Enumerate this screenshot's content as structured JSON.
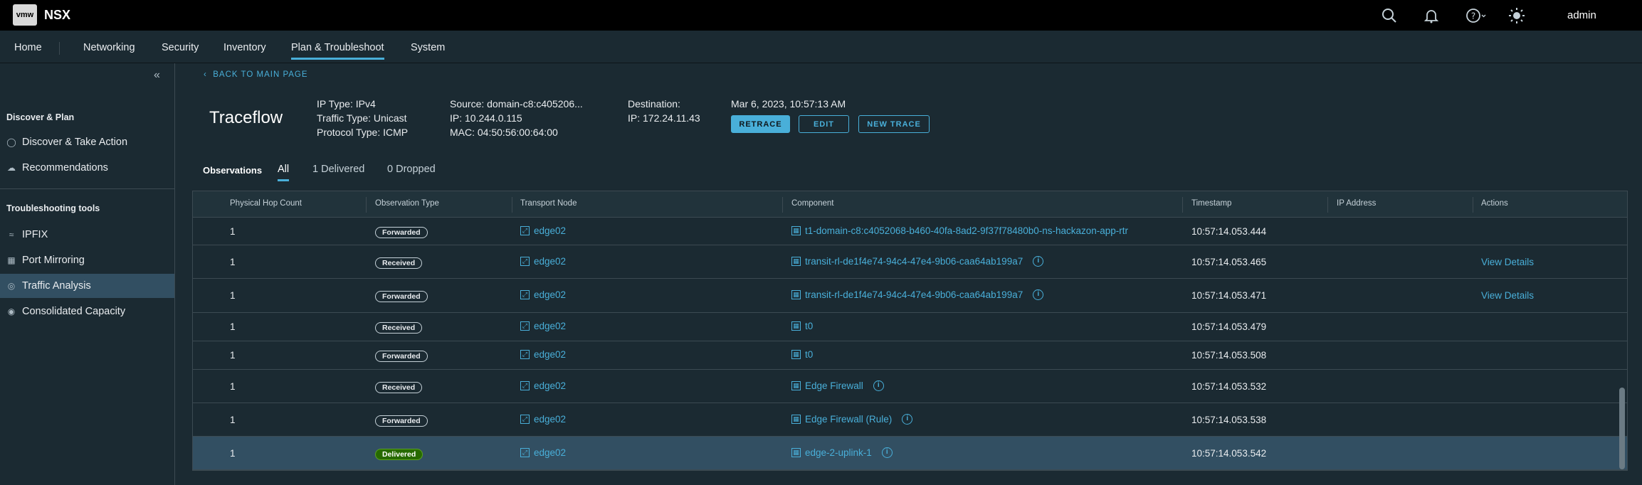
{
  "header": {
    "logo": "vmw",
    "product": "NSX",
    "user": "admin",
    "icons": [
      "search-icon",
      "bell-icon",
      "help-icon",
      "theme-sun-icon"
    ]
  },
  "nav": {
    "tabs": [
      "Home",
      "Networking",
      "Security",
      "Inventory",
      "Plan & Troubleshoot",
      "System"
    ],
    "active": "Plan & Troubleshoot"
  },
  "sidebar": {
    "sections": [
      {
        "title": "Discover & Plan",
        "items": [
          "Discover & Take Action",
          "Recommendations"
        ]
      },
      {
        "title": "Troubleshooting tools",
        "items": [
          "IPFIX",
          "Port Mirroring",
          "Traffic Analysis",
          "Consolidated Capacity"
        ]
      }
    ],
    "active": "Traffic Analysis"
  },
  "page": {
    "back_label": "BACK TO MAIN PAGE",
    "title": "Traceflow",
    "ip_type": "IP Type: IPv4",
    "traffic_type": "Traffic Type: Unicast",
    "protocol_type": "Protocol Type: ICMP",
    "source": "Source: domain-c8:c405206...",
    "source_ip": "IP: 10.244.0.115",
    "source_mac": "MAC: 04:50:56:00:64:00",
    "destination": "Destination:",
    "destination_ip": "IP: 172.24.11.43",
    "date": "Mar 6, 2023, 10:57:13 AM",
    "buttons": {
      "retrace": "RETRACE",
      "edit": "EDIT",
      "new_trace": "NEW TRACE"
    }
  },
  "observations": {
    "label": "Observations",
    "tabs": [
      "All",
      "1 Delivered",
      "0 Dropped"
    ],
    "active": "All"
  },
  "grid": {
    "columns": [
      "Physical Hop Count",
      "Observation Type",
      "Transport Node",
      "Component",
      "Timestamp",
      "IP Address",
      "Actions"
    ],
    "rows": [
      {
        "hop": "1",
        "type": "Forwarded",
        "node": "edge02",
        "component": "t1-domain-c8:c4052068-b460-40fa-8ad2-9f37f78480b0-ns-hackazon-app-rtr",
        "info": false,
        "timestamp": "10:57:14.053.444",
        "ip": "",
        "action": ""
      },
      {
        "hop": "1",
        "type": "Received",
        "node": "edge02",
        "component": "transit-rl-de1f4e74-94c4-47e4-9b06-caa64ab199a7",
        "info": true,
        "timestamp": "10:57:14.053.465",
        "ip": "",
        "action": "View Details"
      },
      {
        "hop": "1",
        "type": "Forwarded",
        "node": "edge02",
        "component": "transit-rl-de1f4e74-94c4-47e4-9b06-caa64ab199a7",
        "info": true,
        "timestamp": "10:57:14.053.471",
        "ip": "",
        "action": "View Details"
      },
      {
        "hop": "1",
        "type": "Received",
        "node": "edge02",
        "component": "t0",
        "info": false,
        "timestamp": "10:57:14.053.479",
        "ip": "",
        "action": ""
      },
      {
        "hop": "1",
        "type": "Forwarded",
        "node": "edge02",
        "component": "t0",
        "info": false,
        "timestamp": "10:57:14.053.508",
        "ip": "",
        "action": ""
      },
      {
        "hop": "1",
        "type": "Received",
        "node": "edge02",
        "component": "Edge Firewall",
        "info": true,
        "timestamp": "10:57:14.053.532",
        "ip": "",
        "action": ""
      },
      {
        "hop": "1",
        "type": "Forwarded",
        "node": "edge02",
        "component": "Edge Firewall (Rule)",
        "info": true,
        "timestamp": "10:57:14.053.538",
        "ip": "",
        "action": ""
      },
      {
        "hop": "1",
        "type": "Delivered",
        "node": "edge02",
        "component": "edge-2-uplink-1",
        "info": true,
        "timestamp": "10:57:14.053.542",
        "ip": "",
        "action": ""
      }
    ]
  },
  "colors": {
    "accent": "#49afd9",
    "background": "#1b2a32",
    "header": "#000000",
    "delivered": "#266900",
    "selected_row": "#324f62"
  }
}
